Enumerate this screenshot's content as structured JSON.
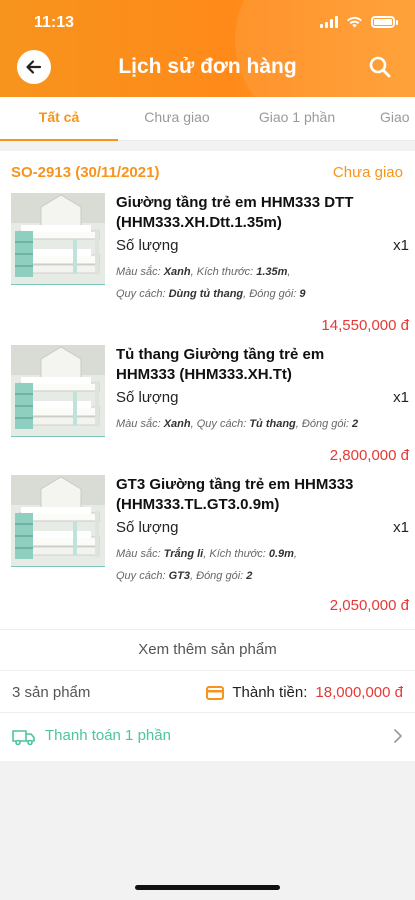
{
  "status_bar": {
    "time": "11:13"
  },
  "header": {
    "title": "Lịch sử đơn hàng",
    "back_icon": "arrow-left-icon",
    "search_icon": "search-icon"
  },
  "tabs": [
    {
      "label": "Tất cả",
      "active": true
    },
    {
      "label": "Chưa giao",
      "active": false
    },
    {
      "label": "Giao 1 phần",
      "active": false
    },
    {
      "label": "Giao",
      "active": false
    }
  ],
  "order": {
    "id": "SO-2913 (30/11/2021)",
    "status": "Chưa giao",
    "items": [
      {
        "name": "Giường tầng trẻ em HHM333 DTT (HHM333.XH.Dtt.1.35m)",
        "qty_label": "Số lượng",
        "qty": "x1",
        "attr_line1": {
          "k1": "Màu sắc:",
          "v1": "Xanh",
          "k2": "Kích thước:",
          "v2": "1.35m"
        },
        "attr_line2": {
          "k1": "Quy cách:",
          "v1": "Dùng tủ thang",
          "k2": "Đóng gói:",
          "v2": "9"
        },
        "price": "14,550,000 đ"
      },
      {
        "name": "Tủ thang Giường tầng trẻ em HHM333 (HHM333.XH.Tt)",
        "qty_label": "Số lượng",
        "qty": "x1",
        "attr_line1": {
          "k1": "Màu sắc:",
          "v1": "Xanh",
          "k2": "Quy cách:",
          "v2": "Tủ thang",
          "k3": "Đóng gói:",
          "v3": "2"
        },
        "price": "2,800,000 đ"
      },
      {
        "name": "GT3 Giường tầng trẻ em HHM333 (HHM333.TL.GT3.0.9m)",
        "qty_label": "Số lượng",
        "qty": "x1",
        "attr_line1": {
          "k1": "Màu sắc:",
          "v1": "Trắng li",
          "k2": "Kích thước:",
          "v2": "0.9m"
        },
        "attr_line2": {
          "k1": "Quy cách:",
          "v1": "GT3",
          "k2": "Đóng gói:",
          "v2": "2"
        },
        "price": "2,050,000 đ"
      }
    ],
    "see_more": "Xem thêm sản phẩm",
    "count": "3 sản phẩm",
    "total_label": "Thành tiền:",
    "total_value": "18,000,000 đ",
    "payment": "Thanh toán 1 phần"
  },
  "colors": {
    "accent": "#f7941d",
    "price": "#e53935",
    "payment": "#4cc4a0"
  }
}
